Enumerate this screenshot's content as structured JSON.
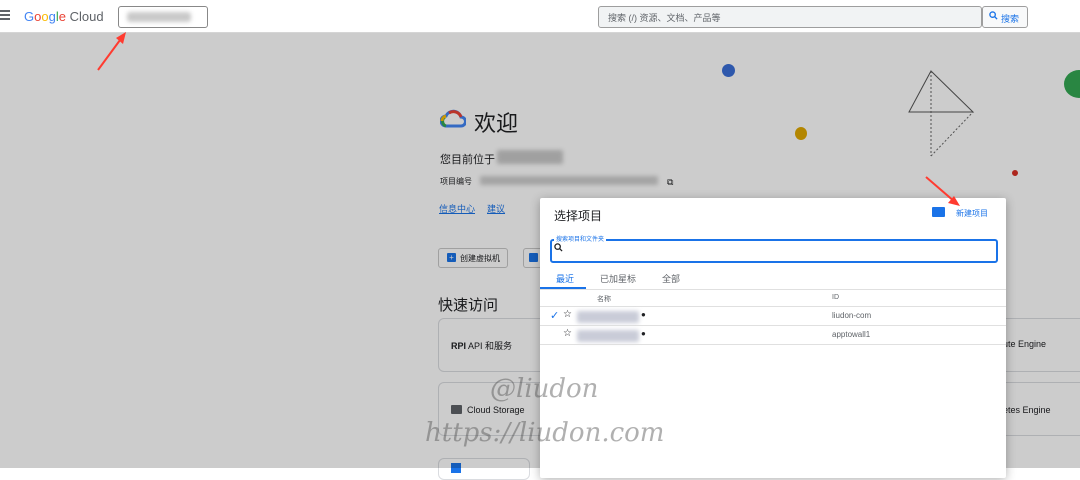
{
  "topbar": {
    "logo_google": "Google",
    "logo_cloud": "Cloud",
    "search_placeholder": "搜索 (/) 资源、文档、产品等",
    "search_button": "搜索"
  },
  "welcome": {
    "title": "欢迎",
    "currently_in": "您目前位于",
    "project_number_label": "项目编号",
    "links": [
      "信息中心",
      "建议"
    ],
    "create_vm": "创建虚拟机"
  },
  "quick_access": {
    "title": "快速访问",
    "cards": [
      "API 和服务",
      "Cloud Storage",
      "ute Engine",
      "etes Engine"
    ]
  },
  "dialog": {
    "title": "选择项目",
    "new_project": "新建项目",
    "search_label": "搜索项目和文件夹",
    "tabs": [
      "最近",
      "已加星标",
      "全部"
    ],
    "active_tab": "最近",
    "columns": {
      "name": "名称",
      "id": "ID"
    },
    "rows": [
      {
        "selected": true,
        "id": "liudon-com"
      },
      {
        "selected": false,
        "id": "apptowall1"
      }
    ]
  },
  "watermark": {
    "line1": "@liudon",
    "line2": "https://liudon.com"
  },
  "colors": {
    "accent": "#1a73e8",
    "arrow": "#ff3b30",
    "dot_blue": "#3a6fd8",
    "dot_yellow": "#e0a800",
    "dot_green": "#34a853",
    "dot_red": "#d93025"
  }
}
